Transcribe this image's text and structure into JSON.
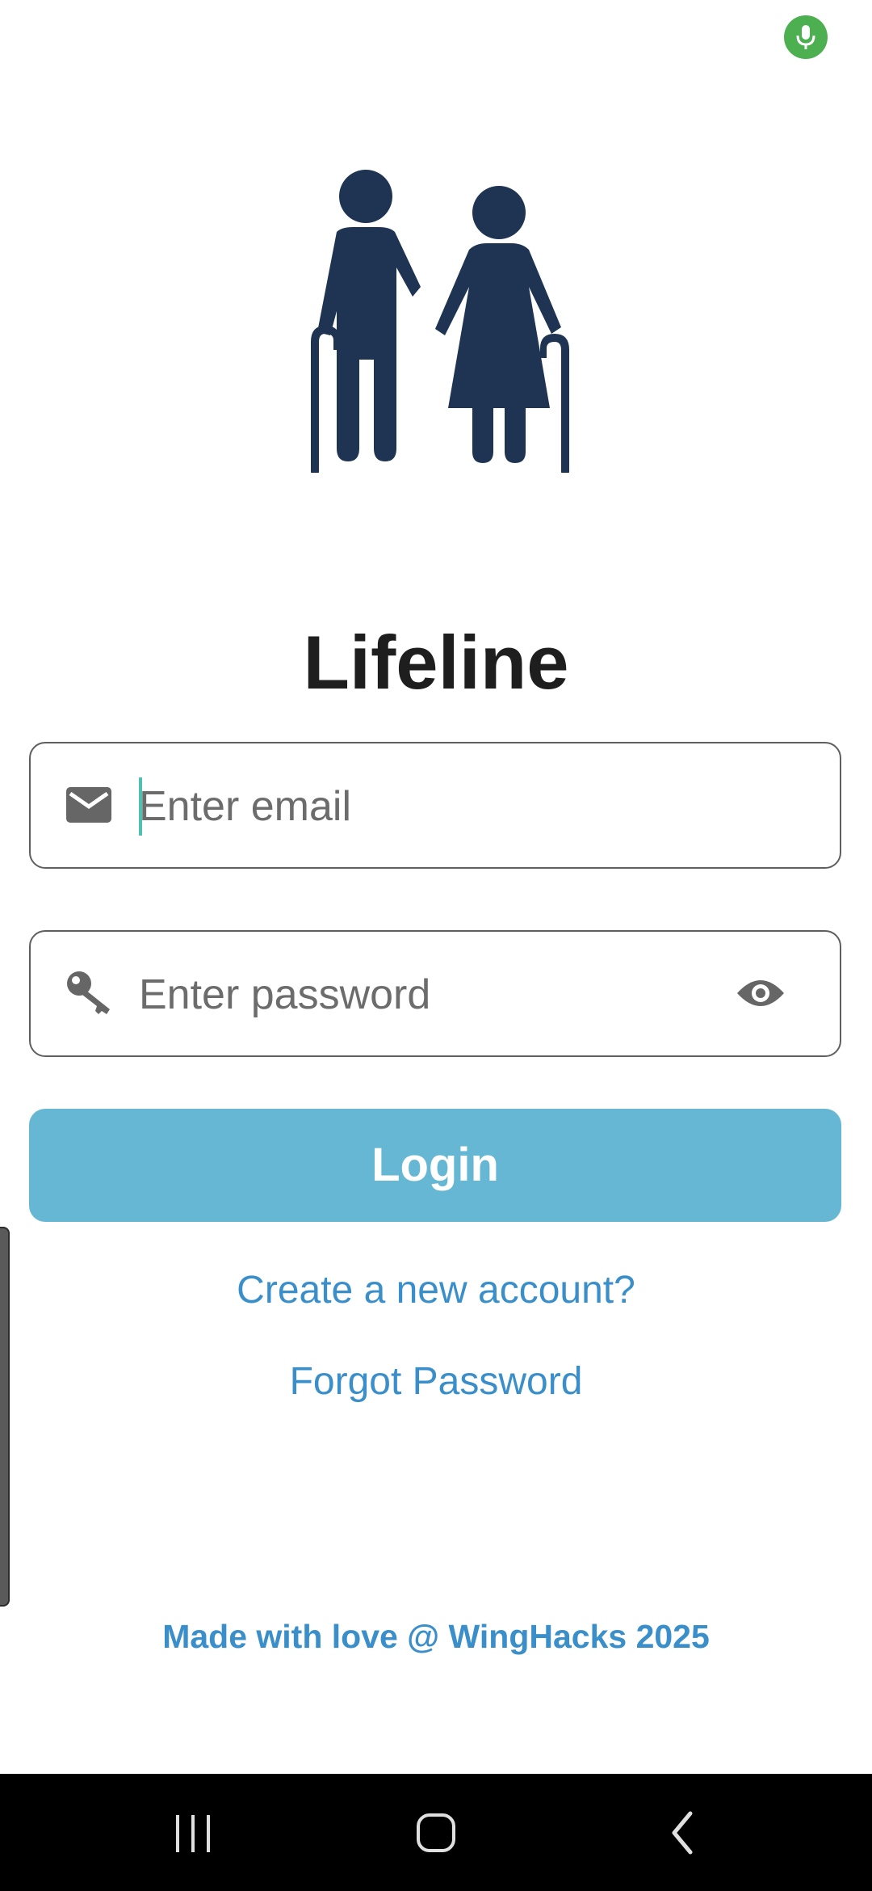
{
  "app": {
    "title": "Lifeline",
    "logo_icon": "elderly-couple-icon",
    "logo_color": "#1f3452"
  },
  "status": {
    "mic_indicator_icon": "microphone-icon",
    "mic_indicator_color": "#4caf50"
  },
  "login_form": {
    "email": {
      "icon": "mail-icon",
      "placeholder": "Enter email",
      "value": "",
      "focused": true
    },
    "password": {
      "icon": "key-icon",
      "placeholder": "Enter password",
      "value": "",
      "visibility_icon": "eye-icon"
    },
    "login_label": "Login",
    "login_color": "#65b7d3"
  },
  "links": {
    "create_account": "Create a new account?",
    "forgot_password": "Forgot Password",
    "link_color": "#3a8fca"
  },
  "footer": {
    "credit": "Made with love @ WingHacks 2025"
  },
  "nav_bar": {
    "recents_icon": "recents-icon",
    "home_icon": "home-icon",
    "back_icon": "back-icon"
  }
}
